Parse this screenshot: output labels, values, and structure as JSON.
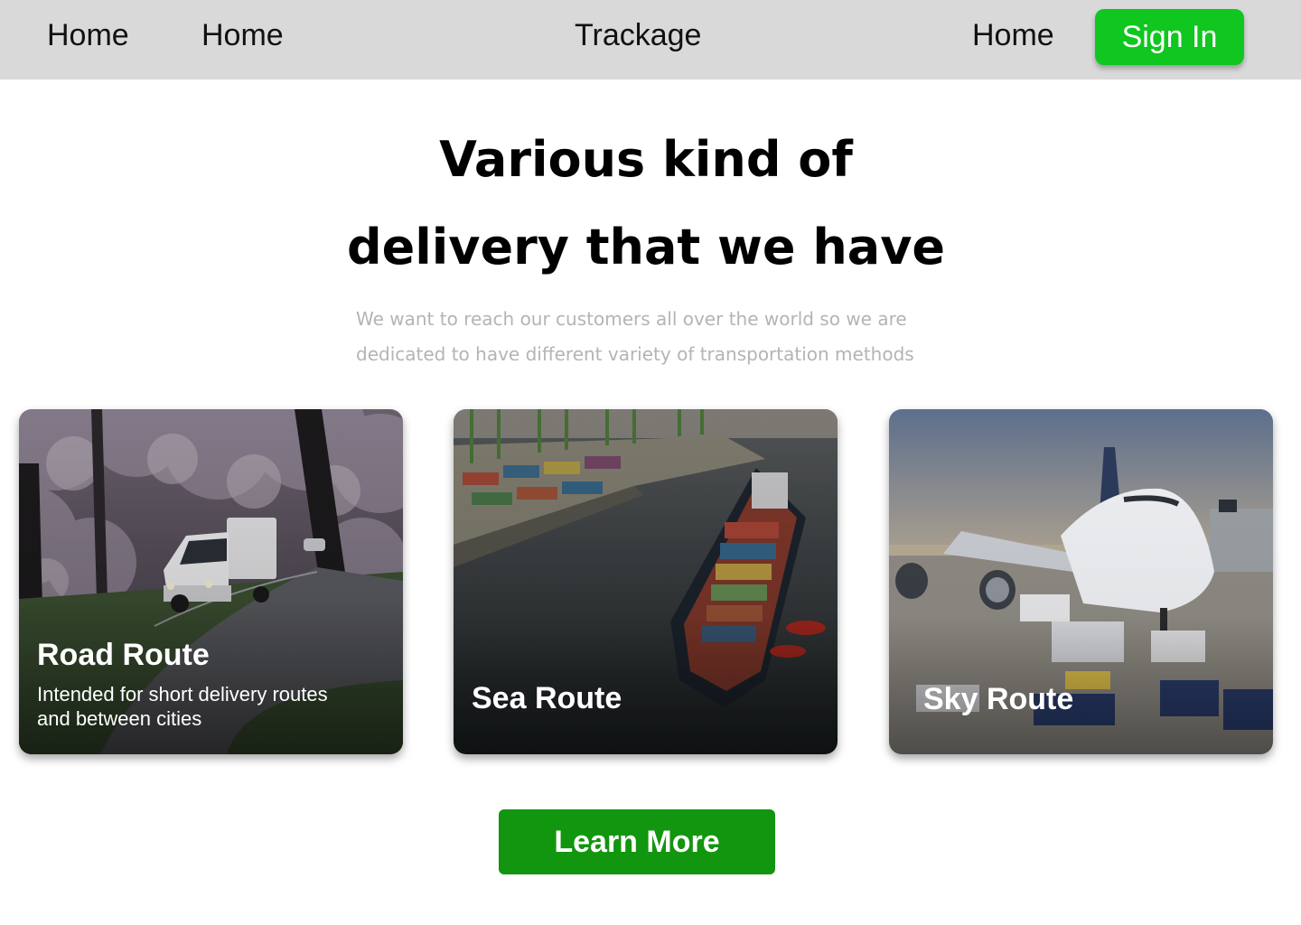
{
  "header": {
    "nav_left": [
      "Home",
      "Home"
    ],
    "brand": "Trackage",
    "nav_right": "Home",
    "sign_in_label": "Sign In"
  },
  "hero": {
    "title_lines": [
      "Various kind of",
      "delivery that we have"
    ],
    "subtitle_lines": [
      "We want to reach our customers all over the world so we are",
      "dedicated to have different variety of transportation methods"
    ]
  },
  "cards": [
    {
      "title": "Road Route",
      "description_lines": [
        "Intended for short delivery routes",
        "and between cities"
      ],
      "image": "white-delivery-van-on-tree-lined-road"
    },
    {
      "title": "Sea Route",
      "description_lines": [],
      "image": "container-ship-at-port-aerial"
    },
    {
      "title": "Sky Route",
      "description_lines": [],
      "image": "jumbo-jet-at-airport-gate"
    }
  ],
  "cta": {
    "label": "Learn More"
  },
  "colors": {
    "header_bg": "#d9d9d9",
    "sign_in_bg": "#0fc71f",
    "learn_more_bg": "#12950f",
    "subtitle_text": "#b4b4b4"
  }
}
